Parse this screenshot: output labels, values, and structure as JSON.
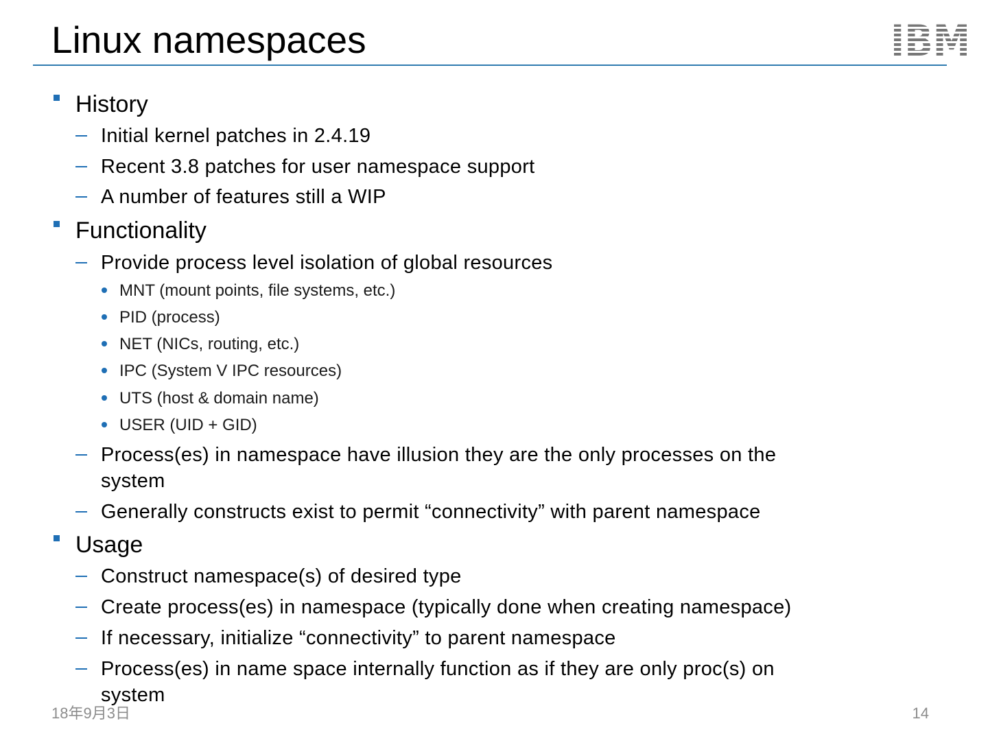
{
  "slide": {
    "title": "Linux namespaces",
    "logo_text": "IBM",
    "accent_color": "#1f6fb5",
    "rule_color": "#2e7bb0"
  },
  "outline": {
    "history": {
      "label": "History",
      "items": [
        "Initial kernel patches in 2.4.19",
        "Recent 3.8 patches for user namespace support",
        "A number of features still a WIP"
      ]
    },
    "functionality": {
      "label": "Functionality",
      "item_1": "Provide process level isolation of global resources",
      "sub_items": [
        "MNT (mount points, file systems, etc.)",
        "PID (process)",
        "NET (NICs, routing, etc.)",
        "IPC (System V IPC resources)",
        "UTS (host & domain name)",
        "USER (UID + GID)"
      ],
      "item_2_line_1": "Process(es) in namespace have illusion they are the only processes on the",
      "item_2_line_2": "system",
      "item_3": "Generally constructs exist to permit “connectivity” with parent namespace"
    },
    "usage": {
      "label": "Usage",
      "items": [
        "Construct namespace(s) of desired type",
        "Create process(es) in namespace (typically done when creating namespace)",
        "If necessary, initialize “connectivity” to parent namespace"
      ],
      "item_4_line_1": "Process(es) in name space internally function as if they are only proc(s) on",
      "item_4_line_2": "system"
    }
  },
  "footer": {
    "date": "18年9月3日",
    "page_number": "14"
  }
}
